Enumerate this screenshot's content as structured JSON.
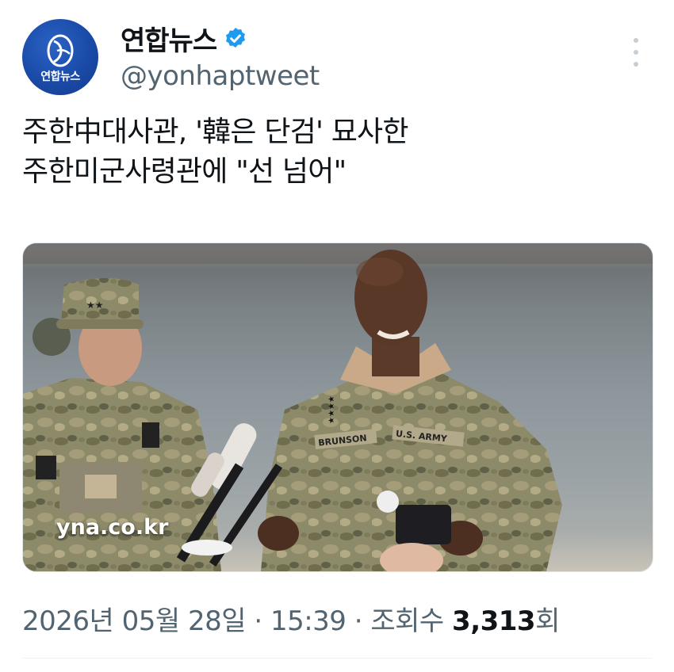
{
  "account": {
    "name": "연합뉴스",
    "handle": "@yonhaptweet",
    "verified": true,
    "avatar_label": "연합뉴스",
    "brand_color": "#1a4aa8",
    "verified_color": "#1d9bf0"
  },
  "tweet": {
    "text_line1": "주한中대사관, '韓은 단검' 묘사한",
    "text_line2": "주한미군사령관에 \"선 넘어\""
  },
  "media": {
    "watermark": "yna.co.kr",
    "left_nametag_stars": "★★",
    "right_rank_stars": "★★★★",
    "right_name_tape": "BRUNSON",
    "right_branch_tape": "U.S. ARMY"
  },
  "meta": {
    "date": "2026년 05월 28일",
    "separator": "·",
    "time": "15:39",
    "views_label": "조회수",
    "views_count": "3,313",
    "views_suffix": "회",
    "text_color": "#536471"
  },
  "icons": {
    "more": "more-options-icon",
    "verified": "verified-badge-icon",
    "logo": "yonhap-globe-icon"
  }
}
